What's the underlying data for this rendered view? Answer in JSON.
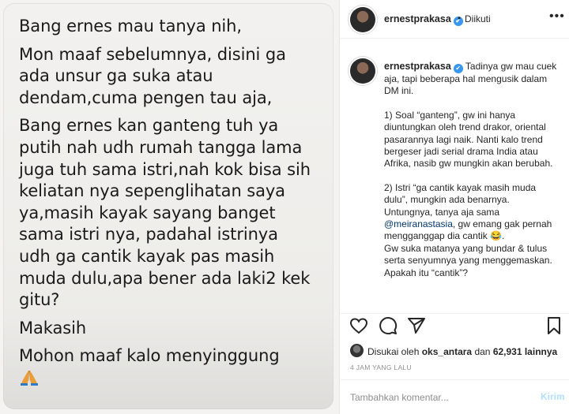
{
  "post_image": {
    "dm_lines": [
      "Bang ernes mau tanya nih,",
      "Mon maaf sebelumnya, disini ga\nada unsur ga suka atau\ndendam,cuma pengen tau aja,",
      "Bang ernes kan ganteng tuh ya\nputih nah udh rumah tangga lama\njuga tuh sama istri,nah kok bisa sih\nkeliatan nya sepenglihatan saya\nya,masih kayak sayang banget\nsama istri nya, padahal istrinya\nudh ga cantik kayak pas masih\nmuda dulu,apa bener ada laki2 kek\ngitu?",
      "Makasih",
      "Mohon maaf kalo menyinggung"
    ],
    "emoji": "folded-hands-emoji"
  },
  "header": {
    "username": "ernestprakasa",
    "separator": "•",
    "follow_status": "Diikuti",
    "more": "•••"
  },
  "caption": {
    "username": "ernestprakasa",
    "p1": "Tadinya gw mau cuek aja, tapi beberapa hal mengusik dalam DM ini.",
    "p2": "1) Soal “ganteng”, gw ini hanya diuntungkan oleh trend drakor, oriental pasarannya lagi naik. Nanti kalo trend bergeser jadi serial drama India atau Afrika, nasib gw mungkin akan berubah.",
    "p3_a": "2) Istri “ga cantik kayak masih muda dulu”, mungkin ada benarnya. Untungnya, tanya aja sama",
    "p3_mention": "@meiranastasia",
    "p3_b": ", gw emang gak pernah mengganggap dia cantik 😂.",
    "p4": "Gw suka matanya yang bundar & tulus serta senyumnya yang menggemaskan. Apakah itu “cantik”?"
  },
  "actions": {
    "icons": [
      "heart-icon",
      "comment-icon",
      "share-icon",
      "bookmark-icon"
    ]
  },
  "likes": {
    "prefix": "Disukai oleh",
    "user": "oks_antara",
    "conj": "dan",
    "count": "62,931 lainnya"
  },
  "timestamp": "4 JAM YANG LALU",
  "comment": {
    "placeholder": "Tambahkan komentar...",
    "post_label": "Kirim"
  },
  "colors": {
    "verified": "#3897f0",
    "mention": "#00376b",
    "post_disabled": "#b2dffc",
    "muted": "#8e8e8e"
  }
}
